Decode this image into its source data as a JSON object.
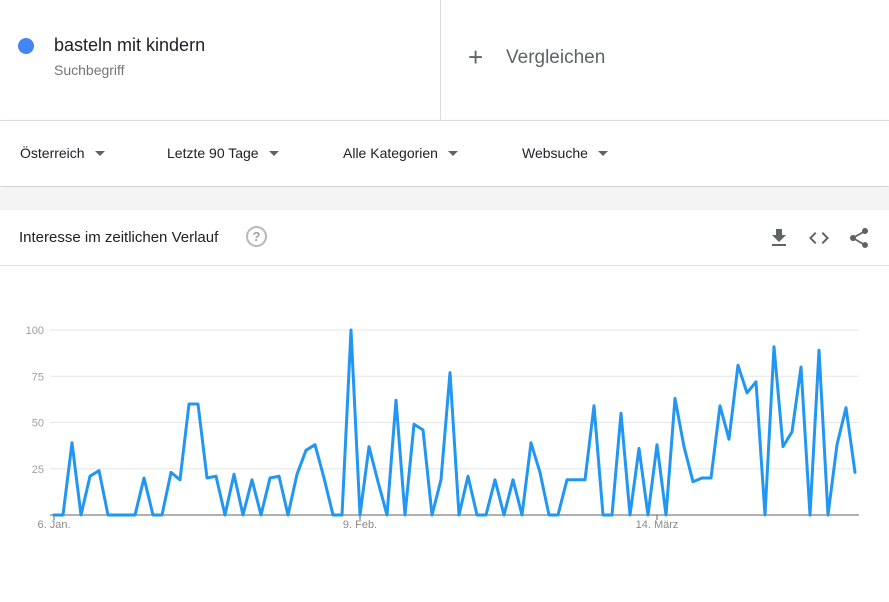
{
  "term": {
    "name": "basteln mit kindern",
    "type": "Suchbegriff",
    "color": "#4285f4"
  },
  "compare": {
    "label": "Vergleichen"
  },
  "filters": [
    {
      "label": "Österreich"
    },
    {
      "label": "Letzte 90 Tage"
    },
    {
      "label": "Alle Kategorien"
    },
    {
      "label": "Websuche"
    }
  ],
  "card": {
    "title": "Interesse im zeitlichen Verlauf"
  },
  "icons": [
    "help-icon",
    "download-icon",
    "embed-icon",
    "share-icon"
  ],
  "chart_data": {
    "type": "line",
    "title": "",
    "xlabel": "",
    "ylabel": "",
    "ylim": [
      0,
      100
    ],
    "yticks": [
      25,
      50,
      75,
      100
    ],
    "xticks": [
      {
        "index": 0,
        "label": "6. Jan."
      },
      {
        "index": 34,
        "label": "9. Feb."
      },
      {
        "index": 67,
        "label": "14. März"
      }
    ],
    "grid": true,
    "color": "#2196f3",
    "series": [
      {
        "values": [
          0,
          0,
          39,
          0,
          21,
          24,
          0,
          0,
          0,
          0,
          20,
          0,
          0,
          23,
          19,
          60,
          60,
          20,
          21,
          0,
          22,
          0,
          19,
          0,
          20,
          21,
          0,
          22,
          35,
          38,
          20,
          0,
          0,
          100,
          0,
          37,
          18,
          0,
          62,
          0,
          49,
          46,
          0,
          19,
          77,
          0,
          21,
          0,
          0,
          19,
          0,
          19,
          0,
          39,
          23,
          0,
          0,
          19,
          19,
          19,
          59,
          0,
          0,
          55,
          0,
          36,
          0,
          38,
          0,
          63,
          37,
          18,
          20,
          20,
          59,
          41,
          81,
          66,
          72,
          0,
          91,
          37,
          45,
          80,
          0,
          89,
          0,
          38,
          58,
          23
        ]
      }
    ]
  }
}
